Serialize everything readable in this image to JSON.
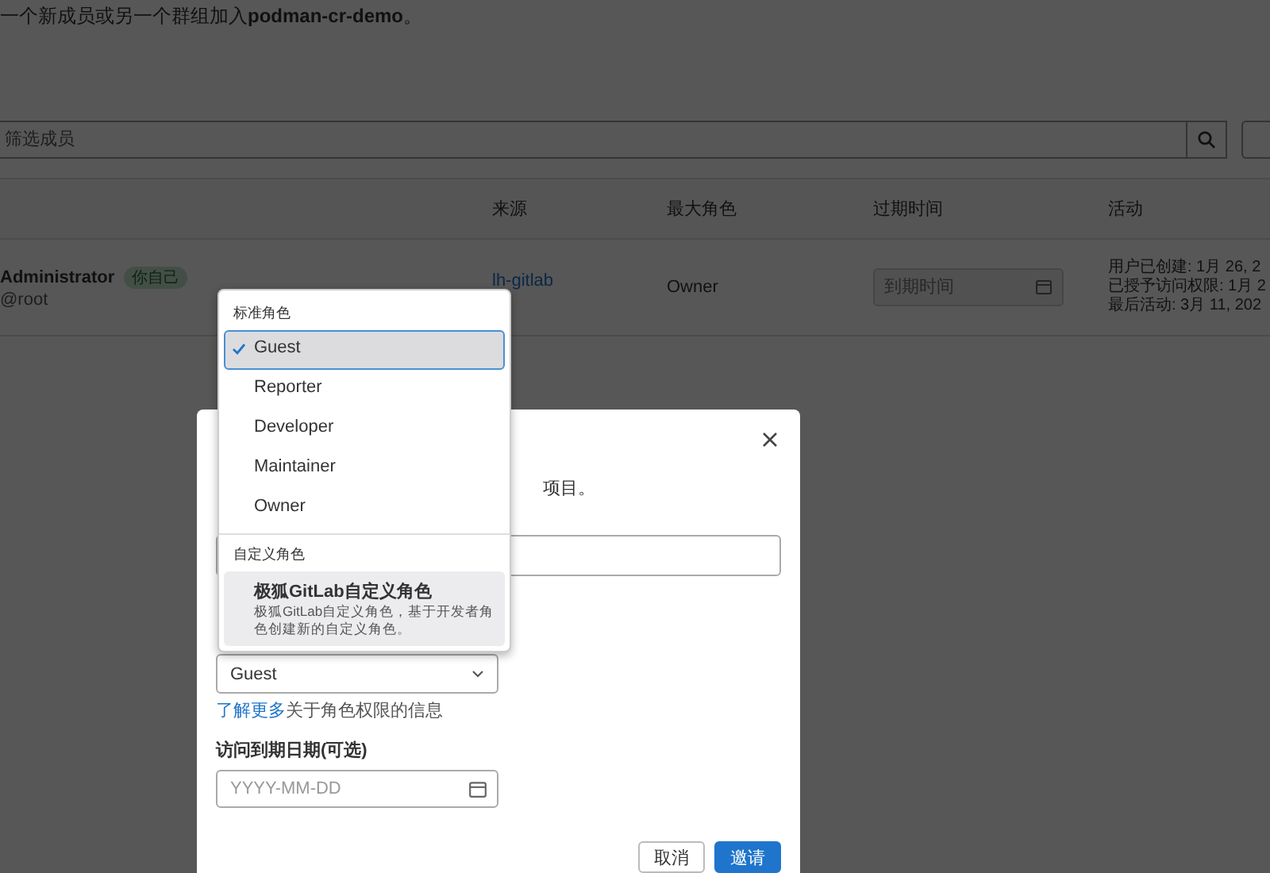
{
  "page": {
    "intro": "一个新成员或另一个群组加入**podman-cr-demo**。",
    "filter": {
      "placeholder": "筛选成员"
    },
    "table": {
      "columns": [
        "来源",
        "最大角色",
        "过期时间",
        "活动"
      ],
      "rows": [
        {
          "name": "Administrator",
          "badge": "你自己",
          "username": "@root",
          "source": "lh-gitlab",
          "max_role": "Owner",
          "expiry": {
            "placeholder": "到期时间"
          },
          "activity": [
            "用户已创建: 1月 26, 2",
            "已授予访问权限: 1月 2",
            "最后活动: 3月 11, 202"
          ]
        }
      ]
    }
  },
  "modal": {
    "intro_tail": "项目。",
    "role_select": {
      "value": "Guest"
    },
    "help": {
      "link": "了解更多",
      "text": "关于角色权限的信息"
    },
    "expiry_label": "访问到期日期(可选)",
    "expiry_field": {
      "placeholder": "YYYY-MM-DD"
    },
    "buttons": [
      {
        "label": "取消",
        "kind": "secondary"
      },
      {
        "label": "邀请",
        "kind": "primary"
      }
    ]
  },
  "dropdown": {
    "groups": [
      {
        "header": "标准角色",
        "items": [
          {
            "label": "Guest",
            "selected": true,
            "highlighted": false
          },
          {
            "label": "Reporter",
            "selected": false,
            "highlighted": false
          },
          {
            "label": "Developer",
            "selected": false,
            "highlighted": false
          },
          {
            "label": "Maintainer",
            "selected": false,
            "highlighted": false
          },
          {
            "label": "Owner",
            "selected": false,
            "highlighted": false
          }
        ]
      },
      {
        "header": "自定义角色",
        "items": [
          {
            "label": "极狐GitLab自定义角色",
            "description": "极狐GitLab自定义角色，基于开发者角色创建新的自定义角色。",
            "selected": false,
            "highlighted": true
          }
        ]
      }
    ]
  }
}
